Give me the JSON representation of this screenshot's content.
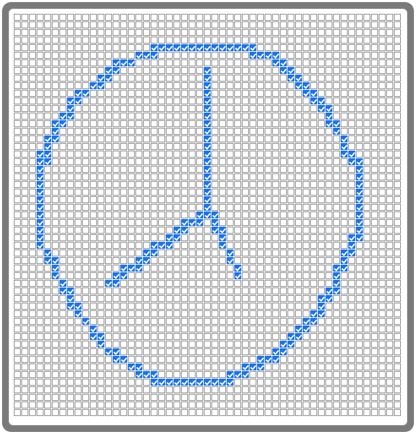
{
  "board": {
    "cols": 51,
    "rows": 53,
    "accent_color": "#1a73e8",
    "frame_color": "#7a7a7a",
    "checked_cells": [
      [
        4,
        18
      ],
      [
        4,
        19
      ],
      [
        4,
        20
      ],
      [
        4,
        21
      ],
      [
        4,
        22
      ],
      [
        4,
        23
      ],
      [
        4,
        24
      ],
      [
        4,
        25
      ],
      [
        4,
        26
      ],
      [
        4,
        27
      ],
      [
        4,
        28
      ],
      [
        4,
        29
      ],
      [
        4,
        30
      ],
      [
        4,
        31
      ],
      [
        5,
        16
      ],
      [
        5,
        17
      ],
      [
        5,
        18
      ],
      [
        5,
        31
      ],
      [
        5,
        32
      ],
      [
        5,
        33
      ],
      [
        5,
        34
      ],
      [
        6,
        13
      ],
      [
        6,
        14
      ],
      [
        6,
        15
      ],
      [
        6,
        34
      ],
      [
        6,
        35
      ],
      [
        7,
        12
      ],
      [
        7,
        13
      ],
      [
        7,
        25
      ],
      [
        7,
        35
      ],
      [
        7,
        36
      ],
      [
        8,
        11
      ],
      [
        8,
        12
      ],
      [
        8,
        25
      ],
      [
        8,
        36
      ],
      [
        8,
        37
      ],
      [
        9,
        10
      ],
      [
        9,
        11
      ],
      [
        9,
        25
      ],
      [
        9,
        37
      ],
      [
        9,
        38
      ],
      [
        10,
        8
      ],
      [
        10,
        9
      ],
      [
        10,
        25
      ],
      [
        10,
        38
      ],
      [
        10,
        39
      ],
      [
        11,
        7
      ],
      [
        11,
        8
      ],
      [
        11,
        25
      ],
      [
        11,
        39
      ],
      [
        11,
        40
      ],
      [
        12,
        7
      ],
      [
        12,
        25
      ],
      [
        12,
        40
      ],
      [
        12,
        41
      ],
      [
        13,
        6
      ],
      [
        13,
        7
      ],
      [
        13,
        25
      ],
      [
        13,
        41
      ],
      [
        14,
        5
      ],
      [
        14,
        6
      ],
      [
        14,
        25
      ],
      [
        14,
        41
      ],
      [
        14,
        42
      ],
      [
        15,
        5
      ],
      [
        15,
        25
      ],
      [
        15,
        42
      ],
      [
        16,
        4
      ],
      [
        16,
        5
      ],
      [
        16,
        25
      ],
      [
        16,
        43
      ],
      [
        17,
        4
      ],
      [
        17,
        25
      ],
      [
        17,
        43
      ],
      [
        18,
        3
      ],
      [
        18,
        4
      ],
      [
        18,
        25
      ],
      [
        18,
        43
      ],
      [
        18,
        44
      ],
      [
        19,
        3
      ],
      [
        19,
        4
      ],
      [
        19,
        25
      ],
      [
        19,
        44
      ],
      [
        19,
        45
      ],
      [
        20,
        3
      ],
      [
        20,
        25
      ],
      [
        20,
        45
      ],
      [
        21,
        3
      ],
      [
        21,
        25
      ],
      [
        21,
        45
      ],
      [
        22,
        3
      ],
      [
        22,
        25
      ],
      [
        22,
        45
      ],
      [
        23,
        3
      ],
      [
        23,
        25
      ],
      [
        23,
        45
      ],
      [
        24,
        3
      ],
      [
        24,
        25
      ],
      [
        24,
        45
      ],
      [
        25,
        3
      ],
      [
        25,
        25
      ],
      [
        25,
        45
      ],
      [
        26,
        3
      ],
      [
        26,
        24
      ],
      [
        26,
        25
      ],
      [
        26,
        26
      ],
      [
        26,
        45
      ],
      [
        27,
        3
      ],
      [
        27,
        22
      ],
      [
        27,
        23
      ],
      [
        27,
        24
      ],
      [
        27,
        26
      ],
      [
        27,
        45
      ],
      [
        28,
        3
      ],
      [
        28,
        21
      ],
      [
        28,
        22
      ],
      [
        28,
        26
      ],
      [
        28,
        27
      ],
      [
        28,
        45
      ],
      [
        29,
        3
      ],
      [
        29,
        20
      ],
      [
        29,
        21
      ],
      [
        29,
        27
      ],
      [
        29,
        44
      ],
      [
        29,
        45
      ],
      [
        30,
        3
      ],
      [
        30,
        18
      ],
      [
        30,
        19
      ],
      [
        30,
        20
      ],
      [
        30,
        27
      ],
      [
        30,
        44
      ],
      [
        31,
        4
      ],
      [
        31,
        17
      ],
      [
        31,
        18
      ],
      [
        31,
        28
      ],
      [
        31,
        43
      ],
      [
        31,
        44
      ],
      [
        32,
        4
      ],
      [
        32,
        5
      ],
      [
        32,
        16
      ],
      [
        32,
        17
      ],
      [
        32,
        28
      ],
      [
        32,
        43
      ],
      [
        33,
        5
      ],
      [
        33,
        14
      ],
      [
        33,
        15
      ],
      [
        33,
        16
      ],
      [
        33,
        29
      ],
      [
        33,
        42
      ],
      [
        33,
        43
      ],
      [
        34,
        5
      ],
      [
        34,
        13
      ],
      [
        34,
        14
      ],
      [
        34,
        29
      ],
      [
        34,
        42
      ],
      [
        35,
        6
      ],
      [
        35,
        12
      ],
      [
        35,
        13
      ],
      [
        35,
        42
      ],
      [
        36,
        6
      ],
      [
        36,
        7
      ],
      [
        36,
        41
      ],
      [
        36,
        42
      ],
      [
        37,
        7
      ],
      [
        37,
        40
      ],
      [
        37,
        41
      ],
      [
        38,
        7
      ],
      [
        38,
        8
      ],
      [
        38,
        40
      ],
      [
        39,
        8
      ],
      [
        39,
        39
      ],
      [
        39,
        40
      ],
      [
        40,
        9
      ],
      [
        40,
        38
      ],
      [
        40,
        39
      ],
      [
        41,
        10
      ],
      [
        41,
        37
      ],
      [
        41,
        38
      ],
      [
        42,
        10
      ],
      [
        42,
        11
      ],
      [
        42,
        36
      ],
      [
        42,
        37
      ],
      [
        43,
        11
      ],
      [
        43,
        35
      ],
      [
        43,
        36
      ],
      [
        44,
        12
      ],
      [
        44,
        13
      ],
      [
        44,
        34
      ],
      [
        44,
        35
      ],
      [
        45,
        13
      ],
      [
        45,
        14
      ],
      [
        45,
        32
      ],
      [
        45,
        33
      ],
      [
        45,
        34
      ],
      [
        46,
        15
      ],
      [
        46,
        16
      ],
      [
        46,
        30
      ],
      [
        46,
        31
      ],
      [
        46,
        32
      ],
      [
        47,
        16
      ],
      [
        47,
        17
      ],
      [
        47,
        18
      ],
      [
        47,
        28
      ],
      [
        47,
        29
      ],
      [
        47,
        30
      ],
      [
        48,
        18
      ],
      [
        48,
        19
      ],
      [
        48,
        20
      ],
      [
        48,
        21
      ],
      [
        48,
        22
      ],
      [
        48,
        23
      ],
      [
        48,
        24
      ],
      [
        48,
        25
      ],
      [
        48,
        26
      ],
      [
        48,
        27
      ],
      [
        48,
        28
      ]
    ]
  }
}
